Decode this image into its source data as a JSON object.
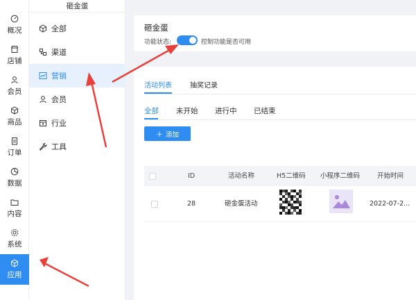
{
  "rail": {
    "items": [
      {
        "label": "概况",
        "icon": "dashboard-icon"
      },
      {
        "label": "店铺",
        "icon": "store-icon"
      },
      {
        "label": "会员",
        "icon": "user-icon"
      },
      {
        "label": "商品",
        "icon": "box-icon"
      },
      {
        "label": "订单",
        "icon": "order-icon"
      },
      {
        "label": "数据",
        "icon": "pie-chart-icon"
      },
      {
        "label": "内容",
        "icon": "folder-icon"
      },
      {
        "label": "系统",
        "icon": "gear-icon"
      },
      {
        "label": "应用",
        "icon": "app-icon"
      }
    ],
    "active_index": 8
  },
  "submenu": {
    "title": "砸金蛋",
    "items": [
      {
        "label": "全部",
        "icon": "cube-icon"
      },
      {
        "label": "渠道",
        "icon": "channel-icon"
      },
      {
        "label": "营销",
        "icon": "trend-icon"
      },
      {
        "label": "会员",
        "icon": "user-icon"
      },
      {
        "label": "行业",
        "icon": "industry-icon"
      },
      {
        "label": "工具",
        "icon": "wrench-icon"
      }
    ],
    "active_index": 2
  },
  "header": {
    "title": "砸金蛋",
    "status_label": "功能状态:",
    "switch_on": true,
    "description": "控制功能是否可用"
  },
  "tabs": [
    "活动列表",
    "抽奖记录"
  ],
  "filters": [
    "全部",
    "未开始",
    "进行中",
    "已结束"
  ],
  "add_button": {
    "icon": "plus-icon",
    "label": "添加"
  },
  "table": {
    "columns": [
      "ID",
      "活动名称",
      "H5二维码",
      "小程序二维码",
      "开始时间"
    ],
    "rows": [
      {
        "id": "28",
        "name": "砸金蛋活动",
        "h5_qr": "qr-code-icon",
        "mini_qr": "image-placeholder-icon",
        "start": "2022-07-2..."
      }
    ]
  },
  "colors": {
    "accent": "#2f8cf0",
    "arrow": "#e8403a",
    "active_bg": "#e6f1fd"
  }
}
